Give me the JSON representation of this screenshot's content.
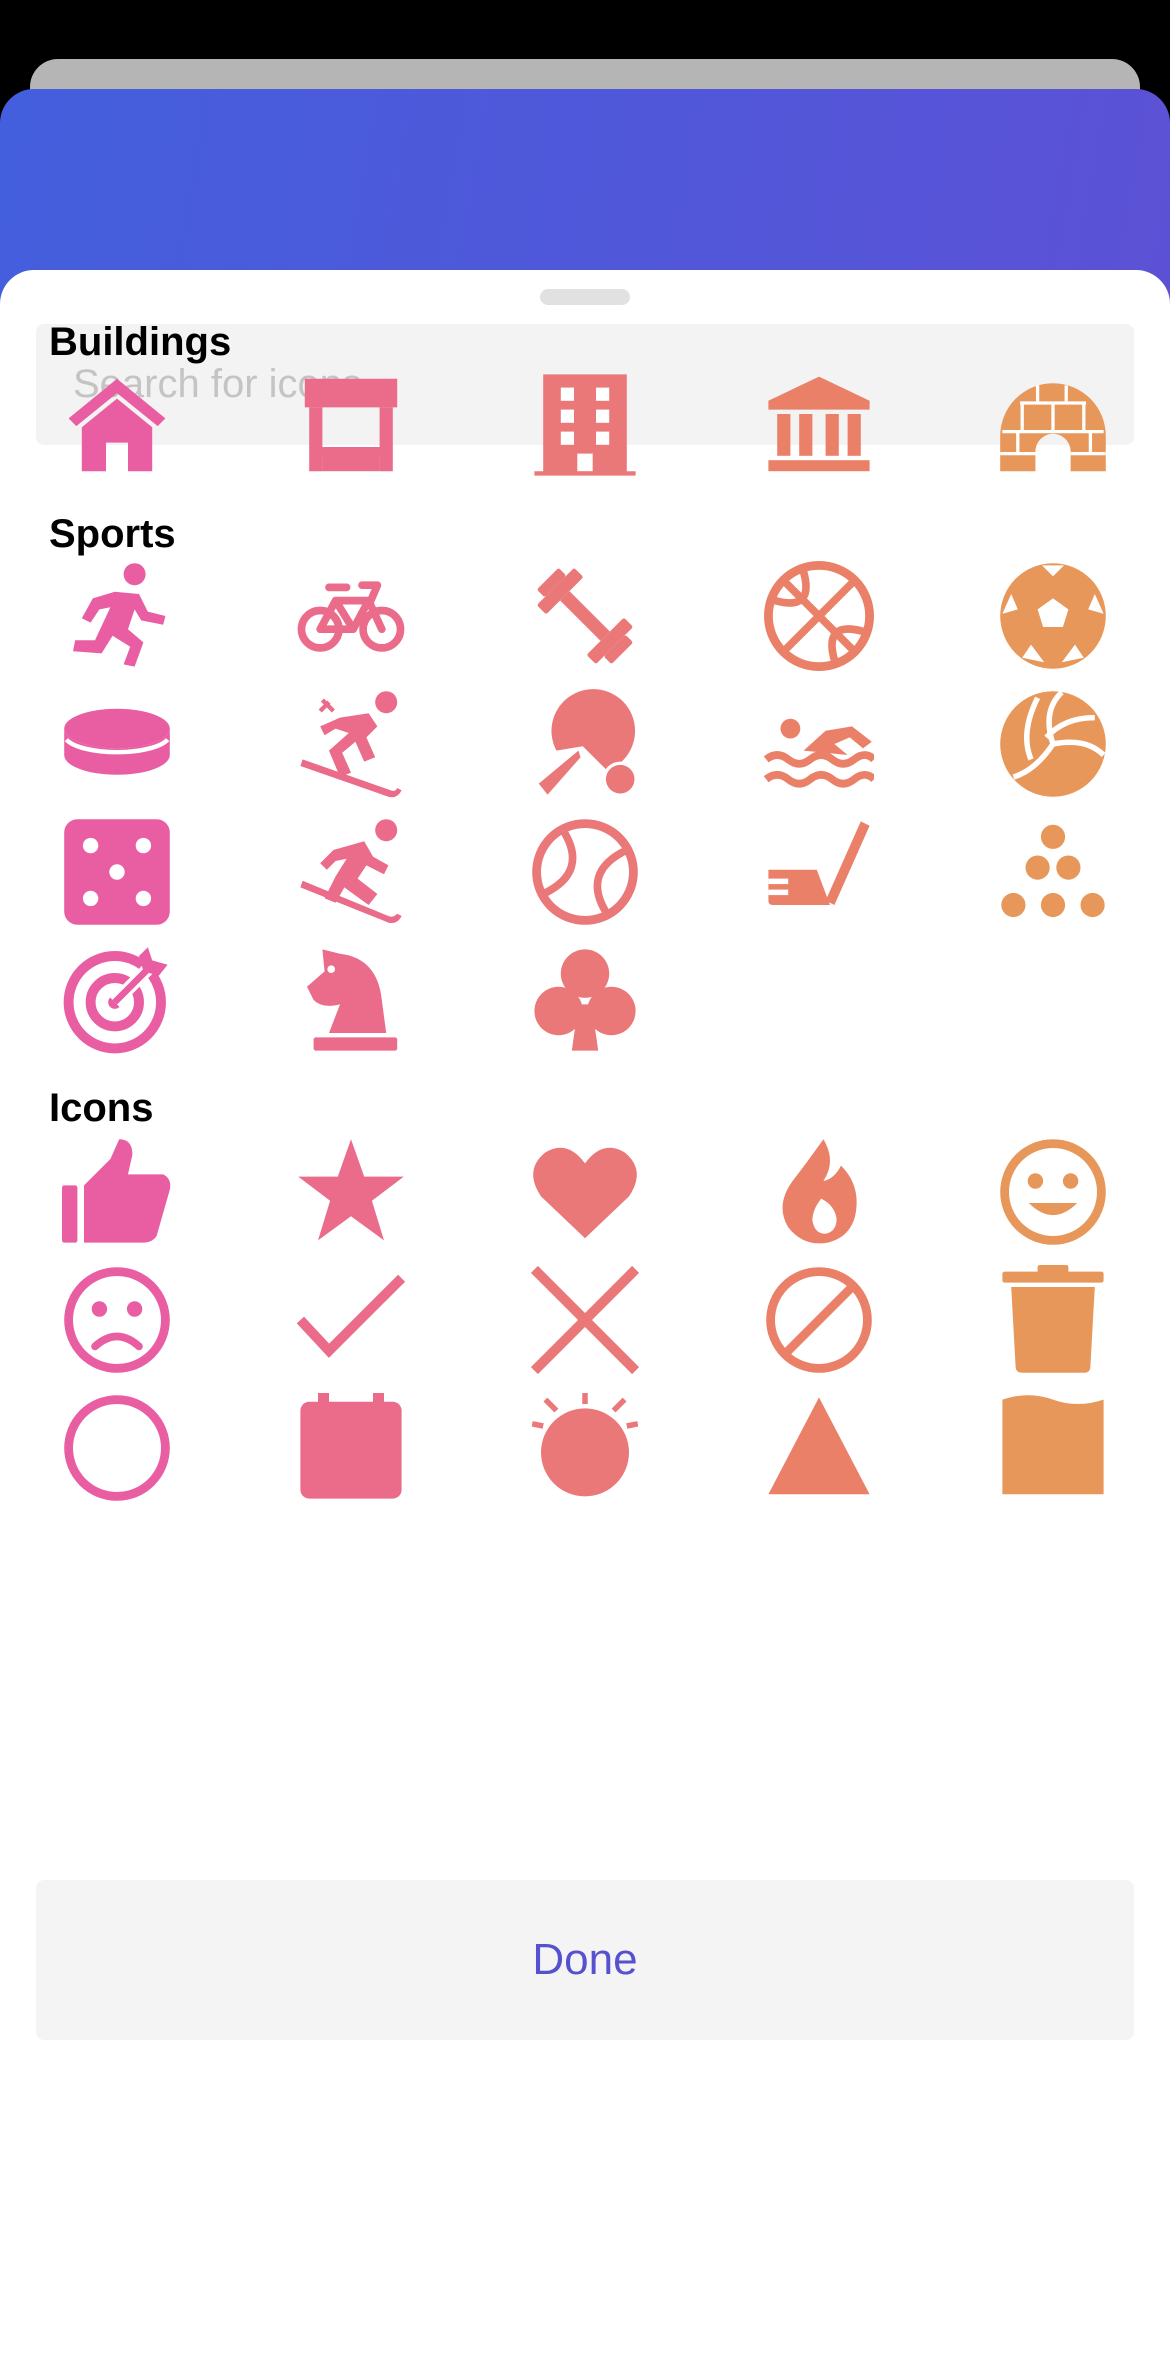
{
  "search": {
    "placeholder": "Search for icons..."
  },
  "sections": [
    {
      "title": "Buildings",
      "icons": [
        "house-icon",
        "store-icon",
        "office-building-icon",
        "bank-icon",
        "igloo-icon"
      ]
    },
    {
      "title": "Sports",
      "icons": [
        "running-person-icon",
        "bicycle-icon",
        "dumbbell-icon",
        "basketball-icon",
        "soccer-ball-icon",
        "hockey-puck-icon",
        "skier-icon",
        "table-tennis-icon",
        "swimmer-icon",
        "volleyball-icon",
        "dice-icon",
        "snowboarder-icon",
        "baseball-icon",
        "golf-club-icon",
        "bowling-pins-icon",
        "bullseye-target-icon",
        "chess-knight-icon",
        "club-suit-icon"
      ]
    },
    {
      "title": "Icons",
      "icons": [
        "thumbs-up-icon",
        "star-icon",
        "heart-icon",
        "fire-icon",
        "smile-face-icon",
        "frown-face-icon",
        "checkmark-icon",
        "x-mark-icon",
        "ban-icon",
        "trash-can-icon",
        "partial-circle-icon",
        "calendar-icon",
        "alarm-clock-icon",
        "triangle-icon",
        "flag-icon"
      ]
    }
  ],
  "colors": {
    "col1": "#e95ea3",
    "col2": "#ea6b8a",
    "col3": "#ea7878",
    "col4": "#ea8068",
    "col5": "#e8975a",
    "header_gradient": [
      "#435fdd",
      "#5c51d6"
    ],
    "done_text": "#5551cf"
  },
  "done_label": "Done"
}
